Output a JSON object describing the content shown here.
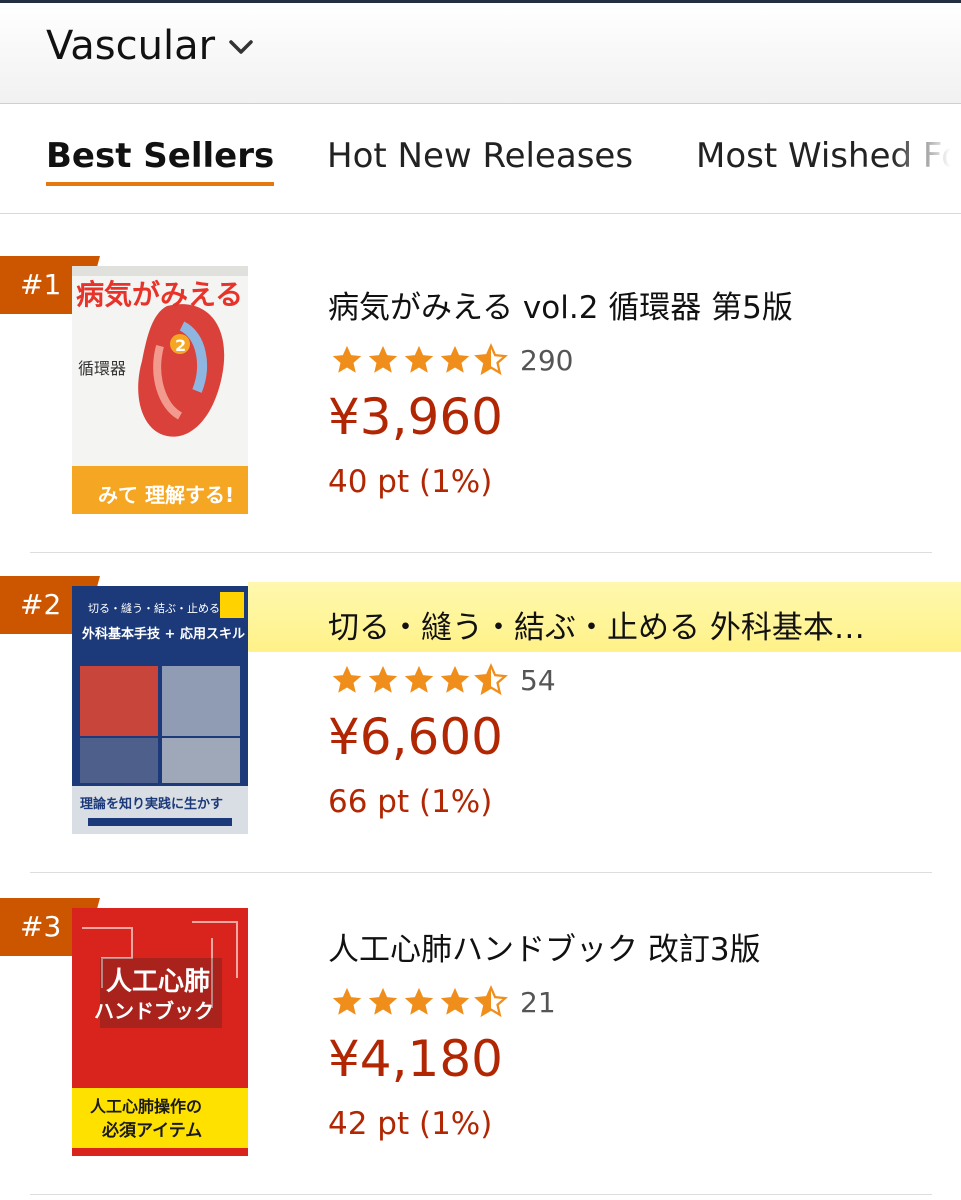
{
  "header": {
    "category": "Vascular",
    "chevron_icon": "chevron-down-icon"
  },
  "tabs": [
    {
      "label": "Best Sellers",
      "active": true
    },
    {
      "label": "Hot New Releases",
      "active": false
    },
    {
      "label": "Most Wished Fo",
      "active": false
    }
  ],
  "colors": {
    "rank_badge": "#cc5500",
    "price": "#b12704",
    "star": "#f08e1b",
    "tab_underline": "#e47911",
    "highlight": "#fff27a"
  },
  "items": [
    {
      "rank": "#1",
      "title": "病気がみえる vol.2 循環器 第5版",
      "rating": 4.5,
      "review_count": "290",
      "price": "¥3,960",
      "points": "40 pt (1%)",
      "cover": {
        "title_text": "病気がみえる",
        "subtitle": "循環器",
        "badge": "2",
        "band_text": "みて 理解する!",
        "colors": {
          "bg": "#f4f4f2",
          "title": "#e8332a",
          "band": "#f5a623"
        }
      },
      "highlighted": false
    },
    {
      "rank": "#2",
      "title": "切る・縫う・結ぶ・止める 外科基本…",
      "rating": 4.5,
      "review_count": "54",
      "price": "¥6,600",
      "points": "66 pt (1%)",
      "cover": {
        "top_text": "切る・縫う・結ぶ・止める",
        "title_text": "外科基本手技 + 応用スキル",
        "bottom_text": "理論を知り実践に生かす",
        "colors": {
          "bg": "#1c3a7a",
          "panel": "#d9dde4",
          "accent": "#ffd200"
        }
      },
      "highlighted": true
    },
    {
      "rank": "#3",
      "title": "人工心肺ハンドブック 改訂3版",
      "rating": 4.5,
      "review_count": "21",
      "price": "¥4,180",
      "points": "42 pt (1%)",
      "cover": {
        "title_text": "人工心肺",
        "title_text2": "ハンドブック",
        "band_text": "人工心肺操作の",
        "band_text2": "必須アイテム",
        "colors": {
          "bg": "#d8241c",
          "band": "#ffe100"
        }
      },
      "highlighted": false
    }
  ]
}
